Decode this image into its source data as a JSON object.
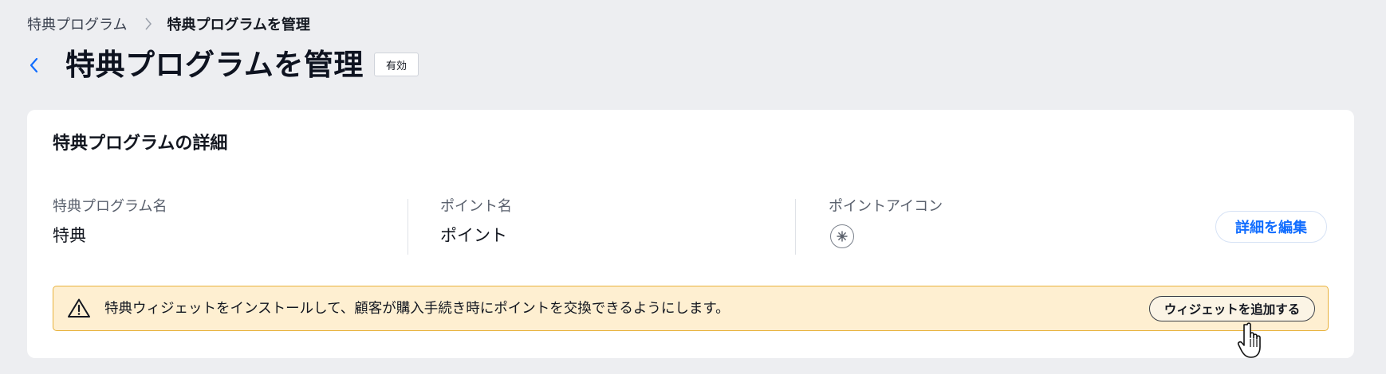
{
  "breadcrumb": {
    "parent": "特典プログラム",
    "current": "特典プログラムを管理",
    "separator_icon": "chevron-right-icon"
  },
  "header": {
    "back_icon": "chevron-left-icon",
    "title": "特典プログラムを管理",
    "status": "有効"
  },
  "card": {
    "title": "特典プログラムの詳細",
    "fields": [
      {
        "label": "特典プログラム名",
        "value": "特典"
      },
      {
        "label": "ポイント名",
        "value": "ポイント"
      },
      {
        "label": "ポイントアイコン",
        "icon": "star-icon"
      }
    ],
    "edit_button": "詳細を編集"
  },
  "banner": {
    "icon": "warning-icon",
    "text": "特典ウィジェットをインストールして、顧客が購入手続き時にポイントを交換できるようにします。",
    "button": "ウィジェットを追加する"
  },
  "colors": {
    "background": "#edeef1",
    "accent": "#116dff",
    "banner_bg": "#feefd1",
    "banner_border": "#e8b23c"
  },
  "cursor": "hand-pointer-icon"
}
